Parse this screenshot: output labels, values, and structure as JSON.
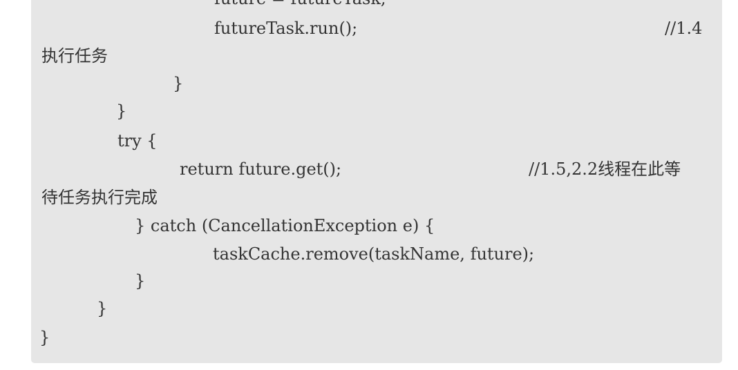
{
  "code": {
    "lines": [
      "future = futureTask;",
      "futureTask.run();",
      "//1.4",
      "执行任务",
      "}",
      "}",
      "try {",
      "return future.get();",
      "//1.5,2.2线程在此等",
      "待任务执行完成",
      "} catch (CancellationException e) {",
      "taskCache.remove(taskName, future);",
      "}",
      "}",
      "}"
    ]
  }
}
